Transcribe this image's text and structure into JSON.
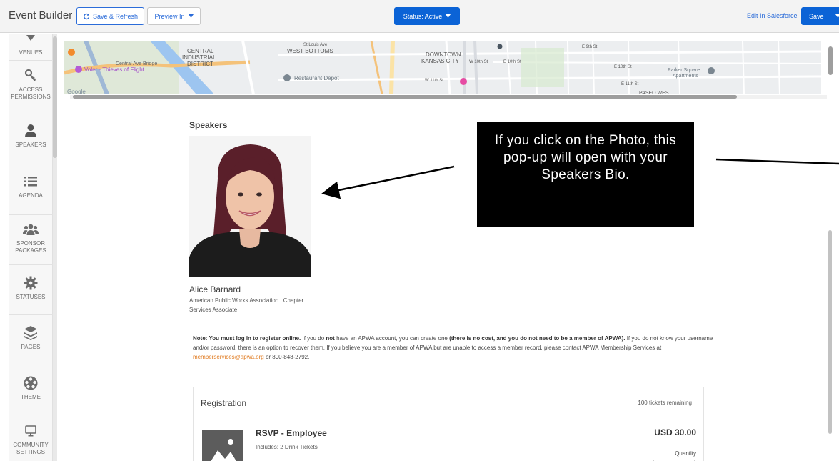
{
  "app": {
    "title": "Event Builder",
    "save_refresh_label": "Save & Refresh",
    "preview_label": "Preview In",
    "status_label": "Status: Active",
    "edit_in_salesforce": "Edit In Salesforce",
    "save_label": "Save"
  },
  "sidebar": {
    "items": [
      {
        "label": "VENUES",
        "icon": "venues-icon"
      },
      {
        "label": "ACCESS PERMISSIONS",
        "icon": "access-key-icon"
      },
      {
        "label": "SPEAKERS",
        "icon": "person-icon"
      },
      {
        "label": "AGENDA",
        "icon": "list-icon"
      },
      {
        "label": "SPONSOR PACKAGES",
        "icon": "group-icon"
      },
      {
        "label": "STATUSES",
        "icon": "gear-icon"
      },
      {
        "label": "PAGES",
        "icon": "layers-icon"
      },
      {
        "label": "THEME",
        "icon": "palette-icon"
      },
      {
        "label": "COMMUNITY SETTINGS",
        "icon": "monitor-icon"
      }
    ]
  },
  "map": {
    "labels": [
      "CENTRAL INDUSTRIAL DISTRICT",
      "WEST BOTTOMS",
      "DOWNTOWN KANSAS CITY",
      "Central Ave Bridge",
      "Voler - Thieves of Flight",
      "Restaurant Depot",
      "Parker Square Apartments",
      "W 10th St",
      "E 10th St",
      "E 9th St",
      "E 11th St",
      "W 11th St",
      "St Louis Ave",
      "PASEO WEST",
      "Google"
    ]
  },
  "speakers": {
    "heading": "Speakers",
    "name": "Alice Barnard",
    "org_line1": "American Public Works Association | Chapter",
    "org_line2": "Services Associate"
  },
  "note": {
    "p1_bold": "Note: You must log in to register online.",
    "p2": " If you do ",
    "p3_bold": "not",
    "p4": " have an APWA account, you can create one ",
    "p5_bold": "(there is no cost, and you do not need to be a member of APWA).",
    "p6": " If you do not know your username and/or password, there is an option to recover them. If you believe you are a member of APWA but are unable to access a member record, please contact APWA Membership Services at ",
    "email": "memberservices@apwa.org",
    "p7": " or 800-848-2792."
  },
  "registration": {
    "title": "Registration",
    "remaining": "100  tickets remaining",
    "ticket_name": "RSVP - Employee",
    "includes": "Includes: 2 Drink Tickets",
    "price": "USD 30.00",
    "quantity_label": "Quantity"
  },
  "callout": {
    "text": "If you click on the Photo, this pop-up will open with your Speakers Bio."
  }
}
